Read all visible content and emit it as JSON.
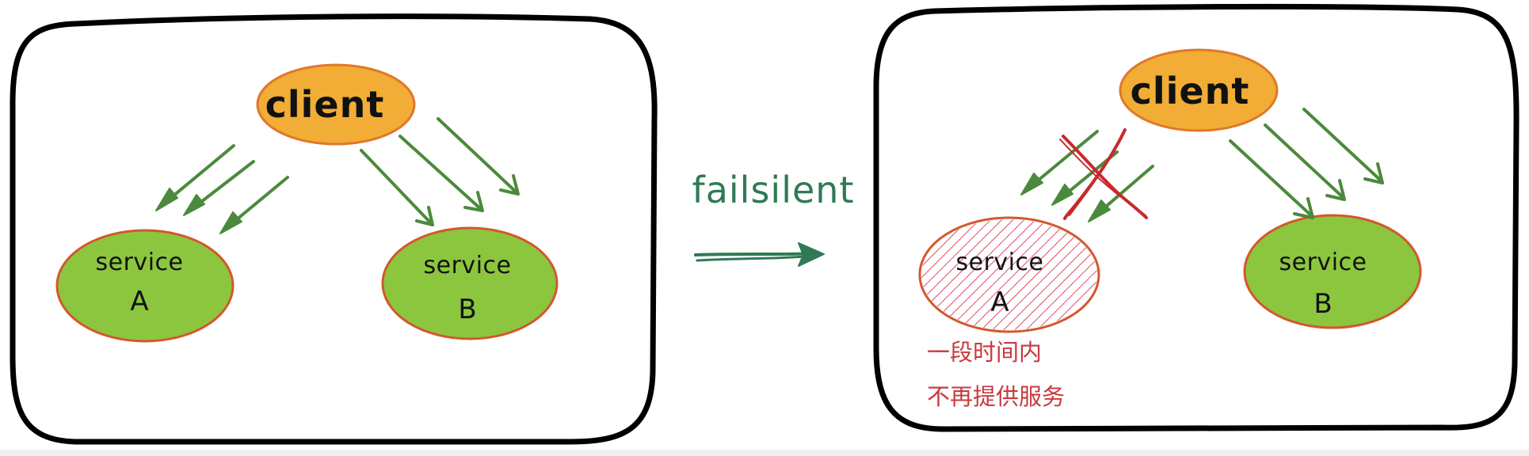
{
  "left_panel": {
    "client_label": "client",
    "service_a": {
      "line1": "service",
      "line2": "A"
    },
    "service_b": {
      "line1": "service",
      "line2": "B"
    }
  },
  "transition": {
    "label": "failsilent"
  },
  "right_panel": {
    "client_label": "client",
    "service_a": {
      "line1": "service",
      "line2": "A"
    },
    "service_b": {
      "line1": "service",
      "line2": "B"
    },
    "note_line1": "一段时间内",
    "note_line2": "不再提供服务"
  },
  "colors": {
    "client_fill": "#f1ad36",
    "client_stroke": "#e0782a",
    "service_fill": "#8cc63f",
    "service_stroke": "#d2582c",
    "failed_stroke": "#d2582c",
    "failed_hatch": "#e04a6a",
    "arrow_green": "#4b8a3c",
    "transition_green": "#2f7a55",
    "cross_red": "#c8292d",
    "note_red": "#c8393d",
    "frame": "#000000"
  }
}
